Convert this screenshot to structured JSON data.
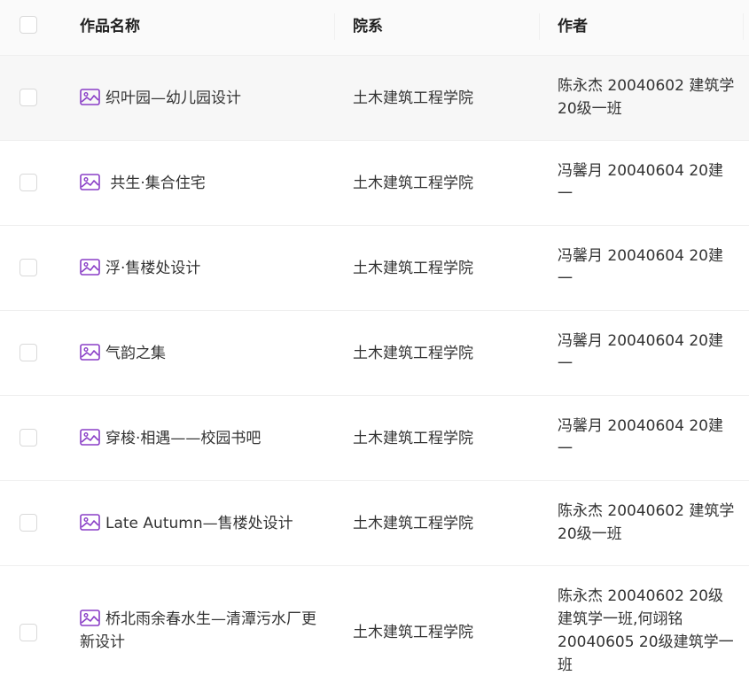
{
  "columns": {
    "name": "作品名称",
    "dept": "院系",
    "author": "作者"
  },
  "icons": {
    "row_icon": "image-icon",
    "accent": "#8a3fc7"
  },
  "rows": [
    {
      "name": "织叶园—幼儿园设计",
      "dept": "土木建筑工程学院",
      "author": "陈永杰 20040602 建筑学20级一班"
    },
    {
      "name": " 共生·集合住宅",
      "dept": "土木建筑工程学院",
      "author": "冯馨月 20040604 20建一"
    },
    {
      "name": "浮·售楼处设计",
      "dept": "土木建筑工程学院",
      "author": "冯馨月 20040604 20建一"
    },
    {
      "name": "气韵之集",
      "dept": "土木建筑工程学院",
      "author": "冯馨月 20040604 20建一"
    },
    {
      "name": "穿梭·相遇——校园书吧",
      "dept": "土木建筑工程学院",
      "author": "冯馨月 20040604 20建一"
    },
    {
      "name": "Late Autumn—售楼处设计",
      "dept": "土木建筑工程学院",
      "author": "陈永杰 20040602 建筑学20级一班"
    },
    {
      "name": "桥北雨余春水生—清潭污水厂更新设计",
      "dept": "土木建筑工程学院",
      "author": "陈永杰 20040602 20级建筑学一班,何翊铭 20040605 20级建筑学一班"
    }
  ]
}
